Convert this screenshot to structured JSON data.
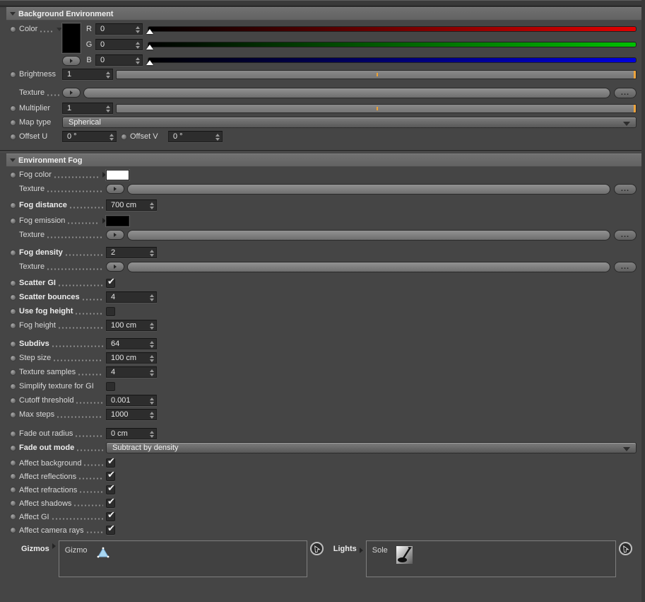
{
  "glyphs": {
    "check": "✔",
    "more": "..."
  },
  "colors": {
    "accent_orange": "#eda33b",
    "panel_background": "#454545",
    "swatch_black": "#000000",
    "swatch_white": "#ffffff",
    "slider_red": "#e10000",
    "slider_green": "#00c000",
    "slider_blue": "#0000dd",
    "gizmo_icon_blue": "#a9d7f2"
  },
  "background": {
    "title": "Background Environment",
    "color": {
      "label": "Color",
      "r": {
        "label": "R",
        "value": "0"
      },
      "g": {
        "label": "G",
        "value": "0"
      },
      "b": {
        "label": "B",
        "value": "0"
      }
    },
    "brightness": {
      "label": "Brightness",
      "value": "1"
    },
    "texture": {
      "label": "Texture",
      "value": ""
    },
    "multiplier": {
      "label": "Multiplier",
      "value": "1"
    },
    "map_type": {
      "label": "Map type",
      "value": "Spherical"
    },
    "offset_u": {
      "label": "Offset U",
      "value": "0 °"
    },
    "offset_v": {
      "label": "Offset V",
      "value": "0 °"
    }
  },
  "fog": {
    "title": "Environment Fog",
    "fog_color": {
      "label": "Fog color"
    },
    "texture1": {
      "label": "Texture",
      "value": ""
    },
    "fog_distance": {
      "label": "Fog distance",
      "value": "700 cm"
    },
    "fog_emission": {
      "label": "Fog emission"
    },
    "texture2": {
      "label": "Texture",
      "value": ""
    },
    "fog_density": {
      "label": "Fog density",
      "value": "2"
    },
    "texture3": {
      "label": "Texture",
      "value": ""
    },
    "scatter_gi": {
      "label": "Scatter GI",
      "checked": true
    },
    "scatter_bounces": {
      "label": "Scatter bounces",
      "value": "4"
    },
    "use_fog_height": {
      "label": "Use fog height",
      "checked": false
    },
    "fog_height": {
      "label": "Fog height",
      "value": "100 cm"
    },
    "subdivs": {
      "label": "Subdivs",
      "value": "64"
    },
    "step_size": {
      "label": "Step size",
      "value": "100 cm"
    },
    "texture_samples": {
      "label": "Texture samples",
      "value": "4"
    },
    "simplify_texture": {
      "label": "Simplify texture for GI",
      "checked": false
    },
    "cutoff_threshold": {
      "label": "Cutoff threshold",
      "value": "0.001"
    },
    "max_steps": {
      "label": "Max steps",
      "value": "1000"
    },
    "fade_out_radius": {
      "label": "Fade out radius",
      "value": "0 cm"
    },
    "fade_out_mode": {
      "label": "Fade out mode",
      "value": "Subtract by density"
    },
    "affect_background": {
      "label": "Affect background",
      "checked": true
    },
    "affect_reflections": {
      "label": "Affect reflections",
      "checked": true
    },
    "affect_refractions": {
      "label": "Affect refractions",
      "checked": true
    },
    "affect_shadows": {
      "label": "Affect shadows",
      "checked": true
    },
    "affect_gi": {
      "label": "Affect GI",
      "checked": true
    },
    "affect_camera_rays": {
      "label": "Affect camera rays",
      "checked": true
    },
    "gizmos": {
      "label": "Gizmos",
      "item": "Gizmo"
    },
    "lights": {
      "label": "Lights",
      "item": "Sole"
    }
  }
}
